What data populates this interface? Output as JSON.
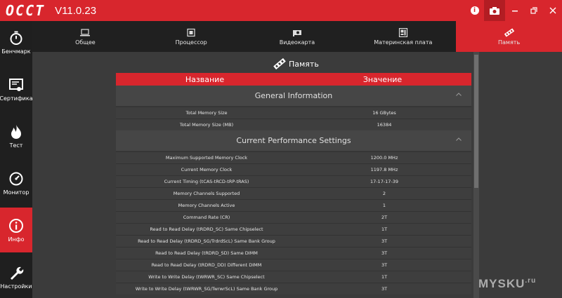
{
  "app": {
    "logo": "OCCT",
    "version": "V11.0.23"
  },
  "sidebar": {
    "items": [
      {
        "label": "Бенчмарк",
        "icon": "stopwatch-icon"
      },
      {
        "label": "Сертифика",
        "icon": "certificate-icon"
      },
      {
        "label": "Тест",
        "icon": "flame-icon"
      },
      {
        "label": "Монитор",
        "icon": "gauge-icon"
      },
      {
        "label": "Инфо",
        "icon": "info-icon"
      },
      {
        "label": "Настройки",
        "icon": "wrench-icon"
      }
    ]
  },
  "tabs": [
    {
      "label": "Общее",
      "icon": "laptop-icon"
    },
    {
      "label": "Процессор",
      "icon": "cpu-icon"
    },
    {
      "label": "Видеокарта",
      "icon": "gpu-icon"
    },
    {
      "label": "Материнская плата",
      "icon": "motherboard-icon"
    },
    {
      "label": "Память",
      "icon": "memory-icon"
    }
  ],
  "main": {
    "section_title": "Память",
    "col_name": "Название",
    "col_value": "Значение",
    "groups": [
      {
        "title": "General Information",
        "rows": [
          {
            "name": "Total Memory Size",
            "value": "16 GBytes"
          },
          {
            "name": "Total Memory Size (MB)",
            "value": "16384"
          }
        ]
      },
      {
        "title": "Current Performance Settings",
        "rows": [
          {
            "name": "Maximum Supported Memory Clock",
            "value": "1200.0 MHz"
          },
          {
            "name": "Current Memory Clock",
            "value": "1197.8 MHz"
          },
          {
            "name": "Current Timing (tCAS-tRCD-tRP-tRAS)",
            "value": "17-17-17-39"
          },
          {
            "name": "Memory Channels Supported",
            "value": "2"
          },
          {
            "name": "Memory Channels Active",
            "value": "1"
          },
          {
            "name": "Command Rate (CR)",
            "value": "2T"
          },
          {
            "name": "Read to Read Delay (tRDRD_SC) Same Chipselect",
            "value": "1T"
          },
          {
            "name": "Read to Read Delay (tRDRD_SG/TrdrdScL) Same Bank Group",
            "value": "3T"
          },
          {
            "name": "Read to Read Delay (tRDRD_SD) Same DIMM",
            "value": "3T"
          },
          {
            "name": "Read to Read Delay (tRDRD_DD) Different DIMM",
            "value": "3T"
          },
          {
            "name": "Write to Write Delay (tWRWR_SC) Same Chipselect",
            "value": "1T"
          },
          {
            "name": "Write to Write Delay (tWRWR_SG/TwrwrScL) Same Bank Group",
            "value": "3T"
          }
        ]
      }
    ]
  },
  "watermark": "MYSKU",
  "watermark_tld": ".ru",
  "colors": {
    "accent": "#d8262d",
    "sidebar": "#1f1f1f",
    "panel": "#3b3b3b"
  }
}
